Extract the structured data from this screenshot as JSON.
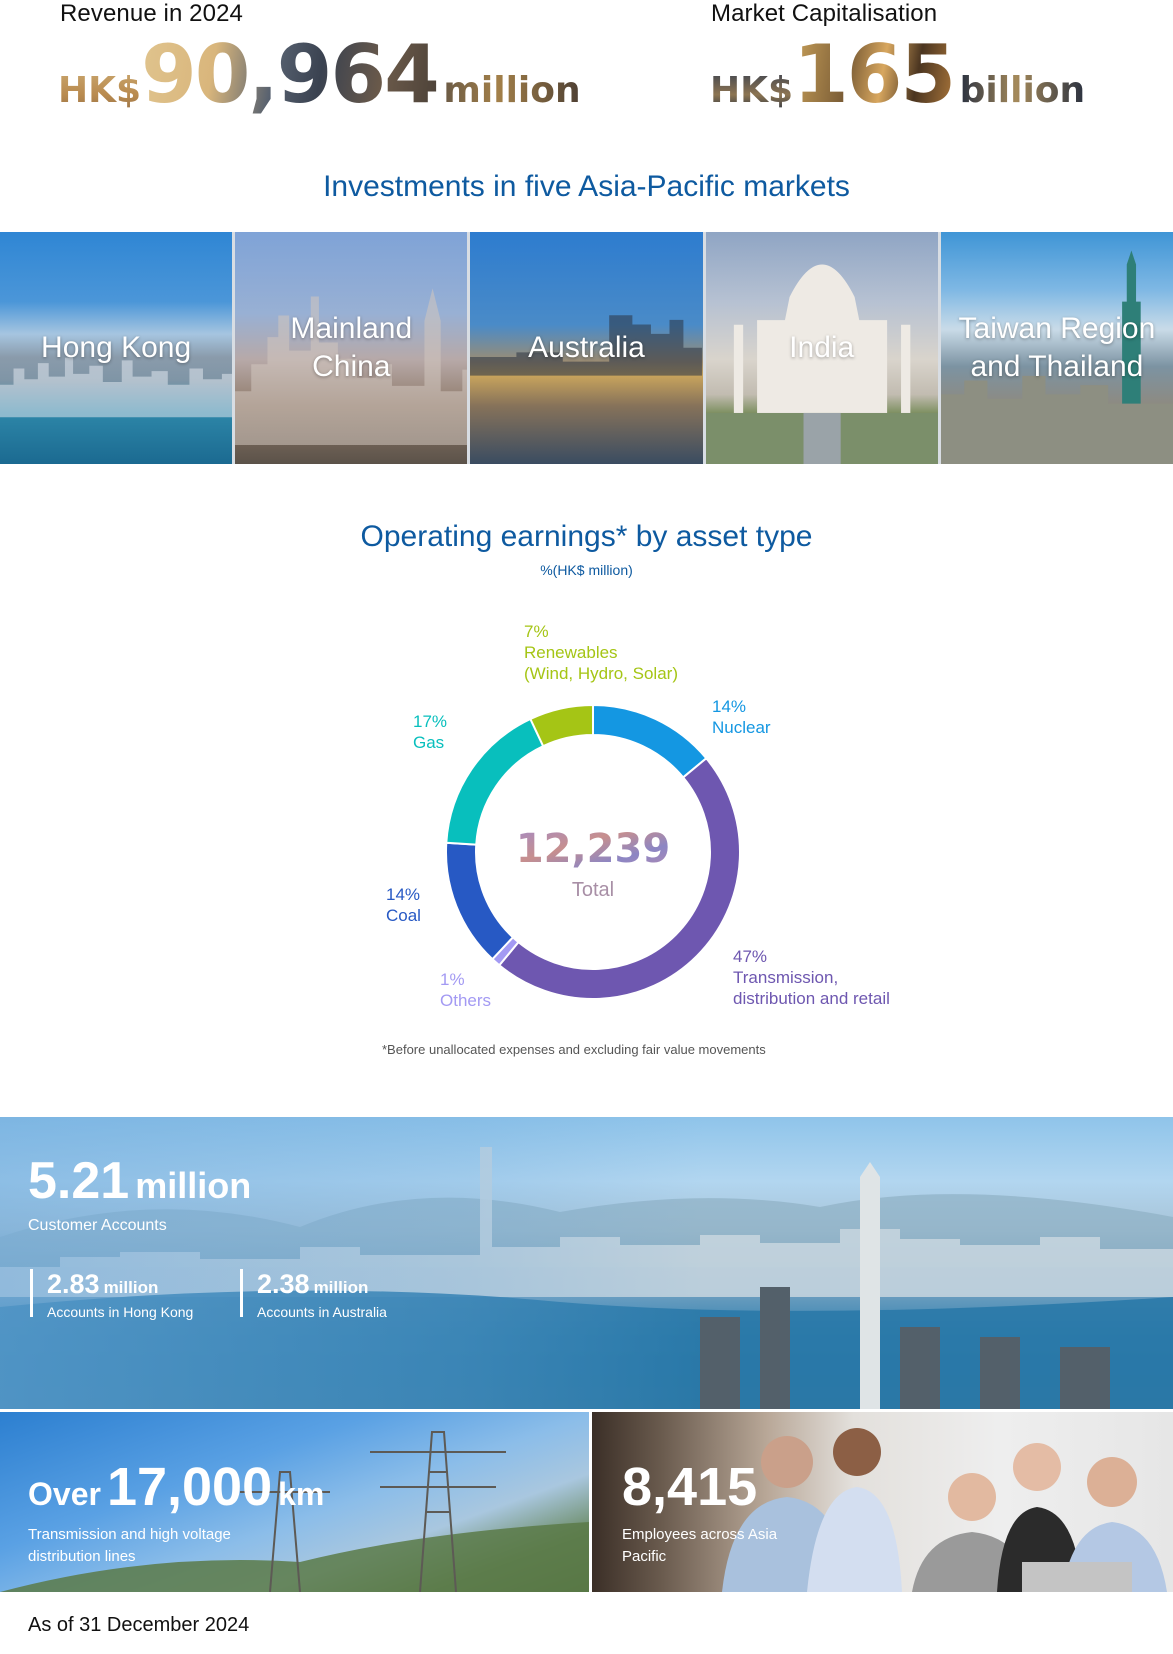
{
  "headline": {
    "revenue": {
      "label": "Revenue in 2024",
      "currency": "HK$",
      "value": "90,964",
      "unit": "million"
    },
    "market_cap": {
      "label": "Market Capitalisation",
      "currency": "HK$",
      "value": "165",
      "unit": "billion"
    }
  },
  "markets": {
    "title": "Investments in five Asia-Pacific markets",
    "items": [
      {
        "label": "Hong Kong"
      },
      {
        "label": "Mainland\nChina"
      },
      {
        "label": "Australia"
      },
      {
        "label": "India"
      },
      {
        "label": "Taiwan Region\nand Thailand"
      }
    ]
  },
  "earnings": {
    "title": "Operating earnings* by asset type",
    "subtitle": "%(HK$ million)",
    "footnote": "*Before unallocated expenses and excluding fair value movements"
  },
  "chart_data": {
    "type": "pie",
    "title": "Operating earnings* by asset type",
    "subtitle": "%(HK$ million)",
    "center_value": "12,239",
    "center_label": "Total",
    "unit": "%",
    "slices": [
      {
        "name": "Nuclear",
        "label_lines": [
          "14%",
          "Nuclear"
        ],
        "value": 14,
        "color": "#1497e2"
      },
      {
        "name": "Transmission, distribution and retail",
        "label_lines": [
          "47%",
          "Transmission,",
          "distribution and retail"
        ],
        "value": 47,
        "color": "#6e57b0"
      },
      {
        "name": "Others",
        "label_lines": [
          "1%",
          "Others"
        ],
        "value": 1,
        "color": "#a39af3"
      },
      {
        "name": "Coal",
        "label_lines": [
          "14%",
          "Coal"
        ],
        "value": 14,
        "color": "#2759c4"
      },
      {
        "name": "Gas",
        "label_lines": [
          "17%",
          "Gas"
        ],
        "value": 17,
        "color": "#08bfbd"
      },
      {
        "name": "Renewables (Wind, Hydro, Solar)",
        "label_lines": [
          "7%",
          "Renewables",
          "(Wind, Hydro, Solar)"
        ],
        "value": 7,
        "color": "#a5c515"
      }
    ],
    "footnote": "*Before unallocated expenses and excluding fair value movements"
  },
  "customers": {
    "total": {
      "value": "5.21",
      "unit": "million",
      "caption": "Customer Accounts"
    },
    "breakdown": [
      {
        "value": "2.83",
        "unit": "million",
        "caption": "Accounts in Hong Kong"
      },
      {
        "value": "2.38",
        "unit": "million",
        "caption": "Accounts in Australia"
      }
    ]
  },
  "lines": {
    "prefix": "Over",
    "value": "17,000",
    "unit": "km",
    "caption": "Transmission and high voltage distribution lines"
  },
  "employees": {
    "value": "8,415",
    "caption": "Employees across Asia Pacific"
  },
  "as_of": "As of 31 December 2024"
}
